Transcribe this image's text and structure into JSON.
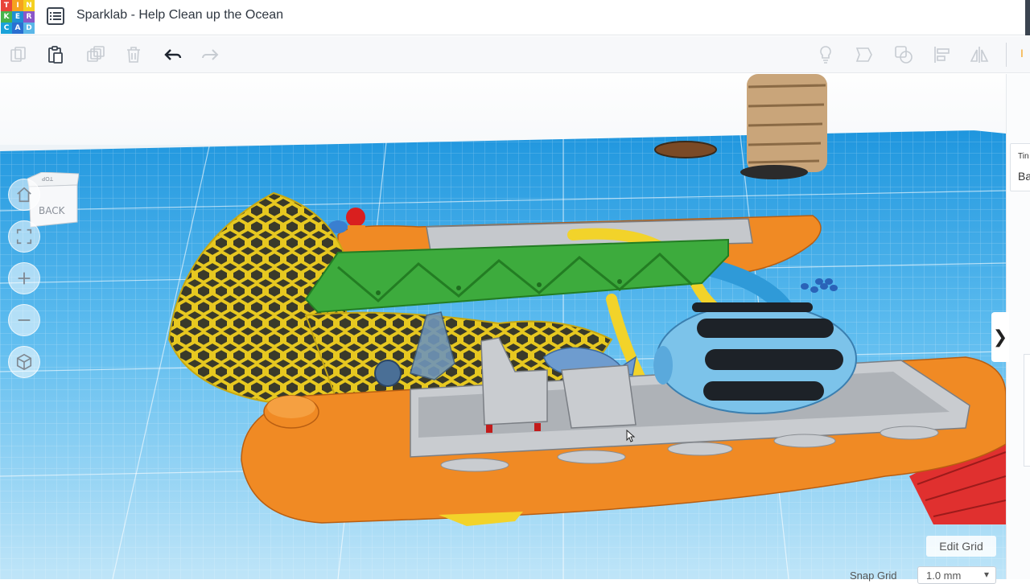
{
  "app": {
    "logo_letters": [
      "T",
      "I",
      "N",
      "K",
      "E",
      "R",
      "C",
      "A",
      "D"
    ],
    "title": "Sparklab - Help Clean up the Ocean"
  },
  "toolbar": {
    "left_icons": [
      "copy-icon",
      "paste-icon",
      "duplicate-icon",
      "delete-icon",
      "undo-icon",
      "redo-icon"
    ],
    "right_icons": [
      "lightbulb-icon",
      "note-icon",
      "group-icon",
      "align-icon",
      "mirror-icon"
    ],
    "edge_text": "I"
  },
  "viewcube": {
    "face_label": "BACK",
    "top_label": "TOP"
  },
  "nav": [
    "home-view-icon",
    "fit-view-icon",
    "zoom-in-icon",
    "zoom-out-icon",
    "perspective-icon"
  ],
  "right_panel": {
    "card_title": "Tin",
    "card_value": "Ba"
  },
  "bottom": {
    "edit_grid": "Edit Grid",
    "snap_grid_label": "Snap Grid",
    "snap_grid_value": "1.0 mm"
  },
  "colors": {
    "grid_blue": "#3aa8e8",
    "boat_orange": "#f08a24",
    "frame_green": "#3dab3d",
    "net_yellow": "#f2d32a",
    "hull_gray": "#c9ccd0",
    "buoy_blue": "#7cc3ea"
  }
}
